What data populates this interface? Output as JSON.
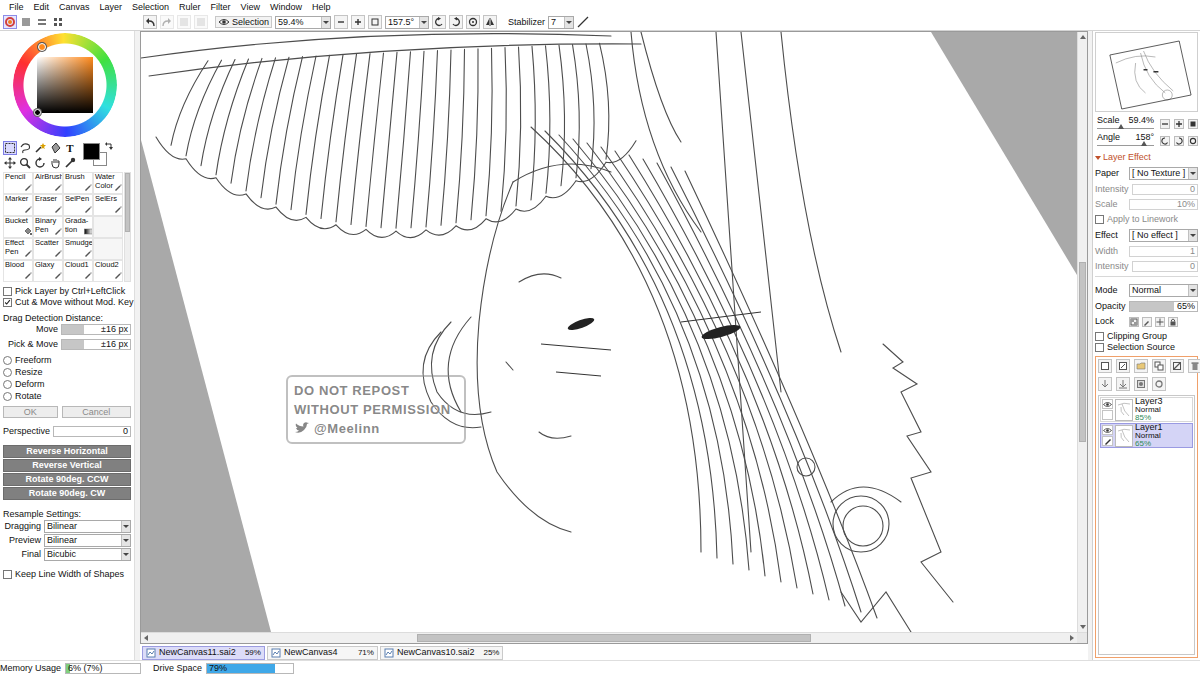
{
  "menu": [
    "File",
    "Edit",
    "Canvas",
    "Layer",
    "Selection",
    "Ruler",
    "Filter",
    "View",
    "Window",
    "Help"
  ],
  "color_modes": [
    {
      "selected": true
    },
    {
      "selected": false
    },
    {
      "selected": false
    },
    {
      "selected": false
    }
  ],
  "history": [
    {
      "disabled": false
    },
    {
      "disabled": true
    },
    {
      "disabled": true
    },
    {
      "disabled": true
    }
  ],
  "toolbar": {
    "selection_label": "Selection",
    "selection_on": true,
    "zoom": "59.4%",
    "angle": "157.5°",
    "stabilizer_label": "Stabilizer",
    "stabilizer": "7"
  },
  "color_picker": {
    "hue": "#ff8a1c",
    "foreground": "#000000",
    "background": "#ffffff"
  },
  "tool_buttons": [
    {
      "selected": true
    },
    {
      "selected": false
    },
    {
      "selected": false
    },
    {
      "selected": false
    },
    {
      "label": "T",
      "selected": false
    },
    {
      "selected": false
    },
    {
      "selected": false
    },
    {
      "selected": false
    },
    {
      "selected": false
    },
    {
      "selected": false
    }
  ],
  "brushes": [
    {
      "label": "Pencil",
      "kind": "pen",
      "selected": false
    },
    {
      "label": "AirBrush",
      "kind": "pen",
      "selected": false
    },
    {
      "label": "Brush",
      "kind": "pen",
      "selected": false
    },
    {
      "label": "Water\nColor",
      "kind": "pen",
      "selected": false
    },
    {
      "label": "Marker",
      "kind": "pen",
      "selected": false
    },
    {
      "label": "Eraser",
      "kind": "pen",
      "selected": false
    },
    {
      "label": "SelPen",
      "kind": "pen",
      "selected": false
    },
    {
      "label": "SelErs",
      "kind": "pen",
      "selected": false
    },
    {
      "label": "Bucket",
      "kind": "bucket",
      "selected": false
    },
    {
      "label": "Binary\nPen",
      "kind": "pen",
      "selected": false
    },
    {
      "label": "Grada-\ntion",
      "kind": "gradient",
      "selected": false
    },
    {
      "kind": "empty"
    },
    {
      "label": "Effect\nPen",
      "kind": "pen",
      "selected": false
    },
    {
      "label": "Scatter",
      "kind": "pen",
      "selected": false
    },
    {
      "label": "Smudge",
      "kind": "pen",
      "selected": false
    },
    {
      "kind": "empty"
    },
    {
      "label": "Blood",
      "kind": "pen",
      "selected": false
    },
    {
      "label": "Glaxy",
      "kind": "pen",
      "selected": false
    },
    {
      "label": "Cloud1",
      "kind": "pen",
      "selected": false
    },
    {
      "label": "Cloud2",
      "kind": "pen",
      "selected": false
    }
  ],
  "brush_scroll": {
    "start": 0,
    "length": 0.55
  },
  "options": {
    "checkboxes": [
      {
        "label": "Pick Layer by Ctrl+LeftClick",
        "checked": false
      },
      {
        "label": "Cut & Move without Mod. Key",
        "checked": true
      }
    ],
    "drag_title": "Drag Detection Distance:",
    "drag_rows": [
      {
        "label": "Move",
        "value": "±16 px",
        "level": 0.32
      },
      {
        "label": "Pick & Move",
        "value": "±16 px",
        "level": 0.32
      }
    ],
    "modes": [
      {
        "label": "Freeform",
        "selected": false
      },
      {
        "label": "Resize",
        "selected": false
      },
      {
        "label": "Deform",
        "selected": false
      },
      {
        "label": "Rotate",
        "selected": false
      }
    ],
    "confirm": [
      {
        "label": "OK",
        "disabled": true
      },
      {
        "label": "Cancel",
        "disabled": true
      }
    ],
    "perspective": {
      "label": "Perspective",
      "value": "0"
    },
    "transforms": [
      "Reverse Horizontal",
      "Reverse Vertical",
      "Rotate 90deg. CCW",
      "Rotate 90deg. CW"
    ],
    "resample_title": "Resample Settings:",
    "resample": [
      {
        "label": "Dragging",
        "value": "Bilinear"
      },
      {
        "label": "Preview",
        "value": "Bilinear"
      },
      {
        "label": "Final",
        "value": "Bicubic"
      }
    ],
    "keep_line": {
      "label": "Keep Line Width of Shapes",
      "checked": false
    }
  },
  "canvas": {
    "watermark": [
      "DO NOT REPOST",
      "WITHOUT PERMISSION",
      "@Meelinn"
    ],
    "scroll_h": {
      "start": 0.29,
      "length": 0.43
    },
    "scroll_v": {
      "start": 0.38,
      "length": 0.31
    }
  },
  "documents": [
    {
      "name": "NewCanvas11.sai2",
      "zoom": "59%",
      "selected": true
    },
    {
      "name": "NewCanvas4",
      "zoom": "71%",
      "selected": false
    },
    {
      "name": "NewCanvas10.sai2",
      "zoom": "25%",
      "selected": false
    }
  ],
  "status": {
    "memory_label": "Memory Usage",
    "memory": "6% (7%)",
    "memory_level": 0.06,
    "drive_label": "Drive Space",
    "drive": "79%",
    "drive_level": 0.79
  },
  "navigator": {
    "scale_label": "Scale",
    "scale": "59.4%",
    "scale_level": 0.42,
    "angle_label": "Angle",
    "angle": "158°",
    "angle_level": 0.82
  },
  "layer_effect": {
    "title": "Layer Effect",
    "expanded": true,
    "paper_label": "Paper",
    "paper": "[ No Texture ]",
    "paper_rows": [
      {
        "label": "Intensity",
        "value": "0",
        "level": 0,
        "disabled": true
      },
      {
        "label": "Scale",
        "value": "10%",
        "level": 0,
        "disabled": true
      }
    ],
    "apply": {
      "label": "Apply to Linework",
      "checked": false,
      "disabled": true
    },
    "effect_label": "Effect",
    "effect": "[ No effect ]",
    "effect_rows": [
      {
        "label": "Width",
        "value": "1",
        "level": 0,
        "disabled": true
      },
      {
        "label": "Intensity",
        "value": "0",
        "level": 0,
        "disabled": true
      }
    ]
  },
  "layer_props": {
    "mode_label": "Mode",
    "mode": "Normal",
    "opacity_label": "Opacity",
    "opacity": "65%",
    "opacity_level": 0.65,
    "lock_label": "Lock",
    "clipping": {
      "label": "Clipping Group",
      "checked": false
    },
    "selection_source": {
      "label": "Selection Source",
      "checked": false
    }
  },
  "layers": [
    {
      "name": "Layer3",
      "mode": "Normal",
      "opacity": "85%",
      "visible": true,
      "selected": false
    },
    {
      "name": "Layer1",
      "mode": "Normal",
      "opacity": "65%",
      "visible": true,
      "selected": true
    }
  ]
}
